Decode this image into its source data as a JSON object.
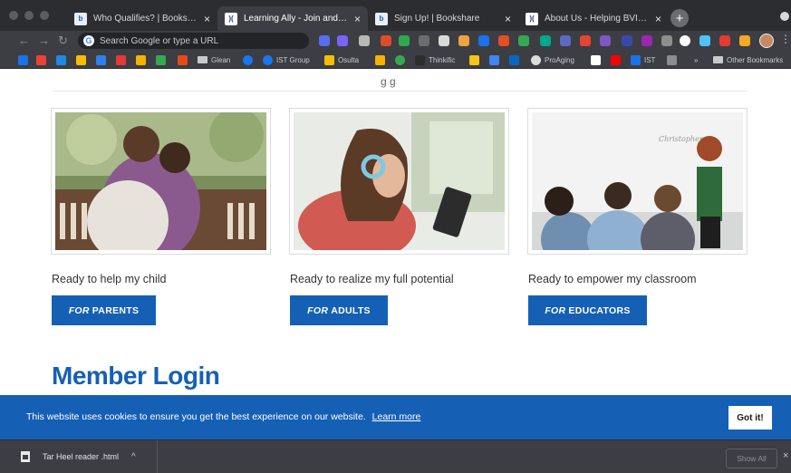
{
  "browser": {
    "tabs": [
      {
        "title": "Who Qualifies? | Bookshare",
        "favicon": "bookshare-icon",
        "active": false
      },
      {
        "title": "Learning Ally - Join and help yo",
        "favicon": "learning-ally-icon",
        "active": true
      },
      {
        "title": "Sign Up! | Bookshare",
        "favicon": "bookshare-icon",
        "active": false
      },
      {
        "title": "About Us - Helping BVI Studen",
        "favicon": "learning-ally-icon",
        "active": false
      }
    ],
    "new_tab_label": "+",
    "omnibox_placeholder": "Search Google or type a URL",
    "bookmarks": [
      {
        "label": "Glean"
      },
      {
        "label": "IST Group"
      },
      {
        "label": "Osulta"
      },
      {
        "label": "Thinkific"
      },
      {
        "label": "ProAging"
      },
      {
        "label": "IST"
      },
      {
        "label": "»"
      },
      {
        "label": "Other Bookmarks"
      }
    ]
  },
  "page": {
    "cut_heading_fragment": "g g",
    "cards": [
      {
        "caption": "Ready to help my child",
        "button_prefix": "FOR",
        "button_label": "PARENTS",
        "image": "parent-hugging-child-photo"
      },
      {
        "caption": "Ready to realize my full potential",
        "button_prefix": "FOR",
        "button_label": "ADULTS",
        "image": "adult-with-tablet-photo"
      },
      {
        "caption": "Ready to empower my classroom",
        "button_prefix": "FOR",
        "button_label": "EDUCATORS",
        "image": "teacher-classroom-photo"
      }
    ],
    "member_login_heading": "Member Login"
  },
  "cookie_banner": {
    "message": "This website uses cookies to ensure you get the best experience on our website.",
    "learn_more": "Learn more",
    "accept": "Got it!"
  },
  "download_shelf": {
    "file_name": "Tar Heel reader .html",
    "chevron": "^",
    "show_all": "Show All",
    "close": "×"
  },
  "colors": {
    "brand_blue": "#1560b5",
    "chrome_dark": "#2b2d31",
    "chrome_toolbar": "#3c3e43"
  }
}
